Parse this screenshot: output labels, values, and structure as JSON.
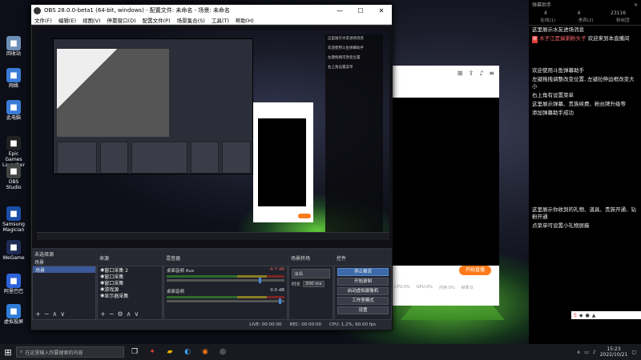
{
  "desktop": {
    "icons": [
      {
        "label": "回收站",
        "icon": "recycle-bin-icon",
        "color": "#6c8fb5"
      },
      {
        "label": "网络",
        "icon": "network-icon",
        "color": "#3a7bd5"
      },
      {
        "label": "此电脑",
        "icon": "computer-icon",
        "color": "#3a7bd5"
      },
      {
        "label": "Epic Games Launcher",
        "icon": "epic-games-icon",
        "color": "#222222"
      },
      {
        "label": "OBS Studio",
        "icon": "obs-icon",
        "color": "#444444"
      },
      {
        "label": "Samsung Magician",
        "icon": "samsung-icon",
        "color": "#1b4ea8"
      },
      {
        "label": "WeGame",
        "icon": "wegame-icon",
        "color": "#1f2d55"
      },
      {
        "label": "阿里巴巴",
        "icon": "alibaba-icon",
        "color": "#2d63d8"
      },
      {
        "label": "虚拟投屏",
        "icon": "screencast-icon",
        "color": "#2f7dd7"
      }
    ]
  },
  "obs": {
    "title": "OBS 28.0.0-beta1 (64-bit, windows) - 配置文件: 未命名 - 场景: 未命名",
    "menu": [
      "文件(F)",
      "编辑(E)",
      "视图(V)",
      "停靠窗口(D)",
      "配置文件(P)",
      "场景集合(S)",
      "工具(T)",
      "帮助(H)"
    ],
    "preview_chat_lines": [
      "这里展示水友进场消息",
      "欢迎使用斗鱼弹幕助手",
      "左键拖拽可改变位置",
      "右上角设置菜单"
    ],
    "docks": {
      "scenes": {
        "title": "场景",
        "items": [
          "场景"
        ]
      },
      "sources": {
        "title": "来源",
        "items": [
          "窗口采集 2",
          "窗口采集",
          "窗口采集",
          "游戏源",
          "显示器采集"
        ]
      },
      "mixer": {
        "title": "混音器",
        "channels": [
          {
            "name": "桌面音频 Aux",
            "db": "-4.7 dB"
          },
          {
            "name": "桌面音频",
            "db": "0.0 dB"
          }
        ]
      },
      "transitions": {
        "title": "场景转场",
        "type": "淡出",
        "duration_label": "时长",
        "duration": "300 ms"
      },
      "controls": {
        "title": "控件",
        "buttons": [
          "停止推流",
          "开始录制",
          "启动虚拟摄像机",
          "工作室模式",
          "设置",
          "退出"
        ]
      }
    },
    "status": {
      "live": "LIVE: 00:00:00",
      "rec": "REC: 00:00:00",
      "cpu": "CPU: 1.2%, 60.00 fps"
    },
    "active_scene_label": "未选择源"
  },
  "side_panel": {
    "title": "弹幕助手",
    "stats": [
      "4",
      "4",
      "23116"
    ],
    "tabs": [
      "在线(1)",
      "贵宾(2)",
      "粉丝团"
    ],
    "messages": [
      {
        "text": "这里展示水友进场消息"
      },
      {
        "badge": "荷",
        "name": "木子江是搞粥粉头子",
        "text": "欢迎来到本直播间"
      },
      {
        "text": "欢迎使用斗鱼弹幕助手"
      },
      {
        "text": "左键拖拽调整改变位置, 左键拉伸边框改变大小"
      },
      {
        "text": "右上角有设置菜单"
      },
      {
        "text": "这里展示弹幕、贵族续费、粉丝牌升级等"
      },
      {
        "text": "添加弹幕助手成功"
      },
      {
        "text": "这里展示你收到的礼物、道具、贵族开通、钻粉开通"
      },
      {
        "text": "点菜单可设置小礼物屏蔽"
      }
    ]
  },
  "live_window": {
    "start_button": "开始直播",
    "stats": [
      "CPU:0%",
      "GPU:0%",
      "内存:0%",
      "帧率:0"
    ]
  },
  "taskbar": {
    "search_placeholder": "在这里输入你要搜索的内容",
    "time": "15:23",
    "date": "2022/10/21"
  }
}
